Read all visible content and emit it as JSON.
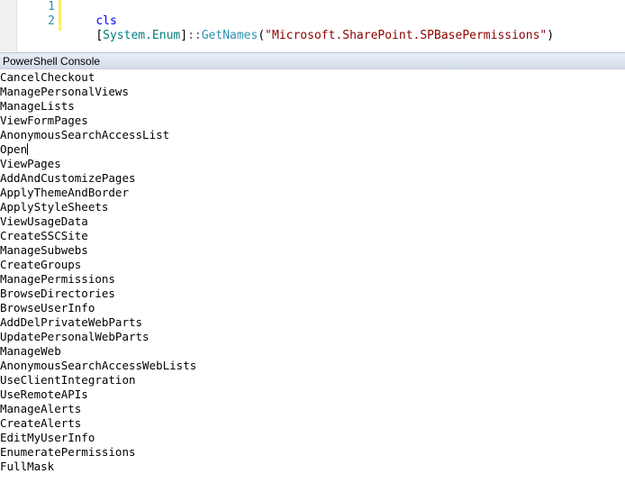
{
  "editor": {
    "line_numbers": [
      "1",
      "2"
    ],
    "lines": [
      {
        "tokens": {
          "keyword": "cls"
        }
      },
      {
        "tokens": {
          "open_bracket": "[",
          "type": "System.Enum",
          "close_bracket": "]",
          "operator": "::",
          "method": "GetNames",
          "open_paren": "(",
          "string": "\"Microsoft.SharePoint.SPBasePermissions\"",
          "close_paren": ")"
        }
      }
    ]
  },
  "console": {
    "title": "PowerShell Console",
    "output": [
      "CancelCheckout",
      "ManagePersonalViews",
      "ManageLists",
      "ViewFormPages",
      "AnonymousSearchAccessList",
      "Open",
      "ViewPages",
      "AddAndCustomizePages",
      "ApplyThemeAndBorder",
      "ApplyStyleSheets",
      "ViewUsageData",
      "CreateSSCSite",
      "ManageSubwebs",
      "CreateGroups",
      "ManagePermissions",
      "BrowseDirectories",
      "BrowseUserInfo",
      "AddDelPrivateWebParts",
      "UpdatePersonalWebParts",
      "ManageWeb",
      "AnonymousSearchAccessWebLists",
      "UseClientIntegration",
      "UseRemoteAPIs",
      "ManageAlerts",
      "CreateAlerts",
      "EditMyUserInfo",
      "EnumeratePermissions",
      "FullMask"
    ]
  },
  "colors": {
    "line_number": "#2b91af",
    "keyword": "#0000ff",
    "type": "#008080",
    "string": "#8b0000",
    "change_bar": "#ffee62",
    "console_header": "#d4dce9"
  }
}
